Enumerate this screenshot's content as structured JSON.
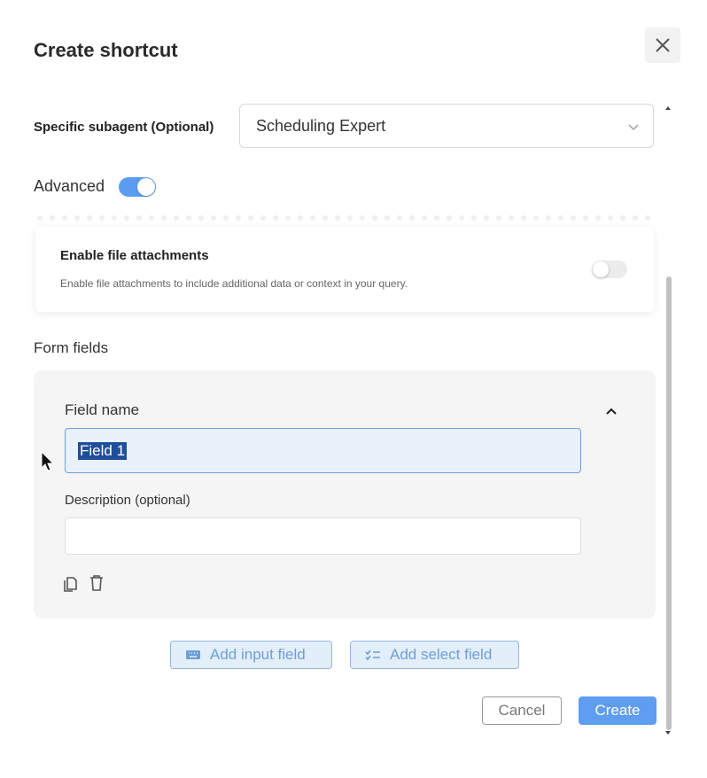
{
  "dialog": {
    "title": "Create shortcut"
  },
  "subagent": {
    "label": "Specific subagent (Optional)",
    "value": "Scheduling Expert"
  },
  "advanced": {
    "label": "Advanced",
    "enabled": true
  },
  "attachments": {
    "title": "Enable file attachments",
    "description": "Enable file attachments to include additional data or context in your query.",
    "enabled": false
  },
  "form": {
    "section_label": "Form fields",
    "field_name_label": "Field name",
    "field_name_value": "Field 1",
    "description_label": "Description (optional)",
    "description_value": ""
  },
  "buttons": {
    "add_input": "Add input field",
    "add_select": "Add select field",
    "cancel": "Cancel",
    "create": "Create"
  },
  "colors": {
    "accent": "#5b9cf0",
    "selection": "#1f4e9c"
  },
  "icons": [
    "close-icon",
    "chevron-down-icon",
    "chevron-up-icon",
    "copy-icon",
    "trash-icon",
    "keyboard-icon",
    "checklist-icon",
    "mouse-pointer-icon"
  ]
}
